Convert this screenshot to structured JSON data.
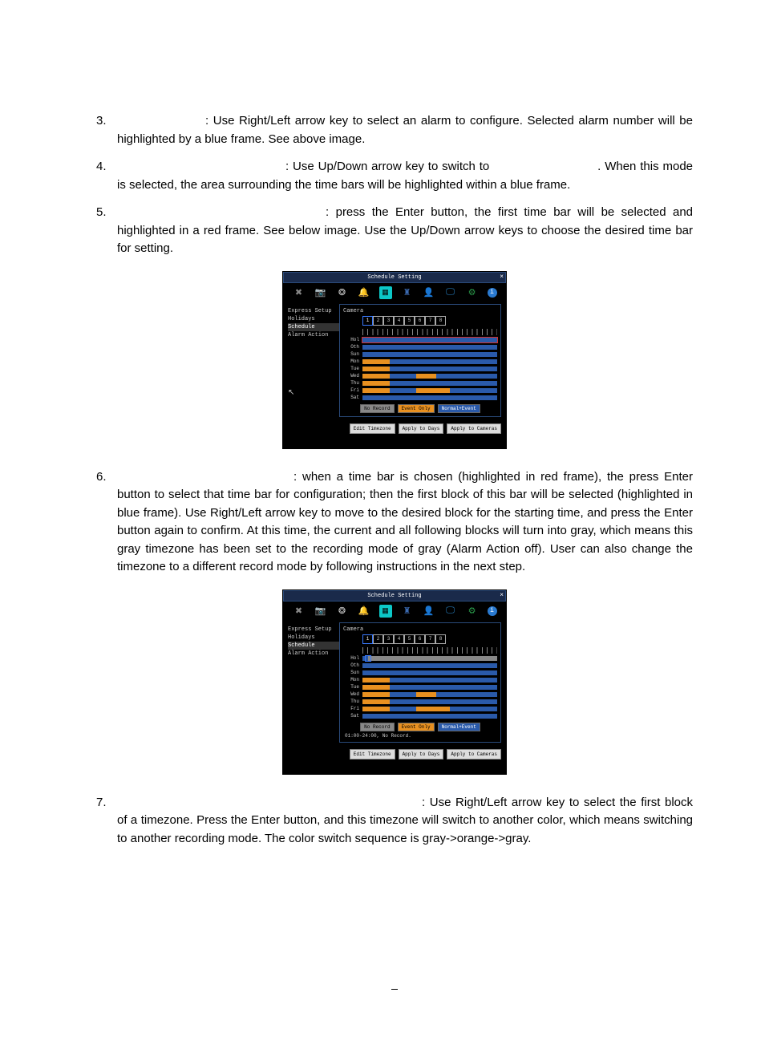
{
  "steps": [
    {
      "num": "3.",
      "label": "",
      "text_a": ": Use Right/Left arrow key to select an alarm to configure. Selected alarm number will be highlighted by a blue frame. See above image."
    },
    {
      "num": "4.",
      "label": "",
      "text_a": ": Use Up/Down arrow key to switch to ",
      "text_b": ". When this mode is selected, the area surrounding the time bars will be highlighted within a blue frame."
    },
    {
      "num": "5.",
      "label": "",
      "text_a": ": press the Enter button, the first time bar will be selected and highlighted in a red frame. See below image. Use the Up/Down arrow keys to choose the desired time bar for setting."
    },
    {
      "num": "6.",
      "label": "",
      "text_a": ": when a time bar is chosen (highlighted in red frame), the press Enter button to select that time bar for configuration; then the first block of this bar will be selected (highlighted in blue frame). Use Right/Left arrow key to move to the desired block for the starting time, and press the Enter button again to confirm. At this time, the current and all following blocks will turn into gray, which means this gray timezone has been set to the recording mode of gray (Alarm Action off).  User can also change the timezone to a different record mode by following instructions in the next step."
    },
    {
      "num": "7.",
      "label": "",
      "text_a": ": Use Right/Left arrow key to select the first block  of a timezone. Press the Enter button, and this timezone will switch to another color, which means switching to another recording mode. The color switch sequence is gray->orange->gray."
    }
  ],
  "dvr": {
    "title": "Schedule Setting",
    "side": [
      "Express Setup",
      "Holidays",
      "Schedule",
      "Alarm Action"
    ],
    "side_selected": 2,
    "camera_label": "Camera",
    "cameras": [
      "1",
      "2",
      "3",
      "4",
      "5",
      "6",
      "7",
      "8"
    ],
    "camera_selected": 0,
    "days": [
      "Hol",
      "Oth",
      "Sun",
      "Mon",
      "Tue",
      "Wed",
      "Thu",
      "Fri",
      "Sat"
    ],
    "legend": [
      "No Record",
      "Event Only",
      "Normal+Event"
    ],
    "status_fig2": "01:00-24:00, No Record.",
    "buttons": [
      "Edit Timezone",
      "Apply to Days",
      "Apply to Cameras"
    ]
  },
  "page_number": ""
}
